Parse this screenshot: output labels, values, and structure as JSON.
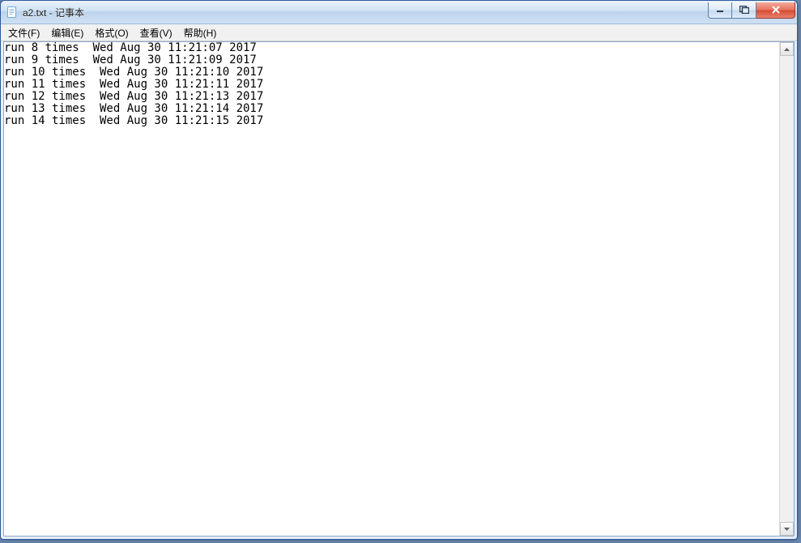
{
  "window": {
    "title": "a2.txt - 记事本"
  },
  "menu": {
    "file": "文件(F)",
    "edit": "编辑(E)",
    "format": "格式(O)",
    "view": "查看(V)",
    "help": "帮助(H)"
  },
  "content": {
    "lines": [
      "run 8 times  Wed Aug 30 11:21:07 2017",
      "run 9 times  Wed Aug 30 11:21:09 2017",
      "run 10 times  Wed Aug 30 11:21:10 2017",
      "run 11 times  Wed Aug 30 11:21:11 2017",
      "run 12 times  Wed Aug 30 11:21:13 2017",
      "run 13 times  Wed Aug 30 11:21:14 2017",
      "run 14 times  Wed Aug 30 11:21:15 2017"
    ]
  }
}
